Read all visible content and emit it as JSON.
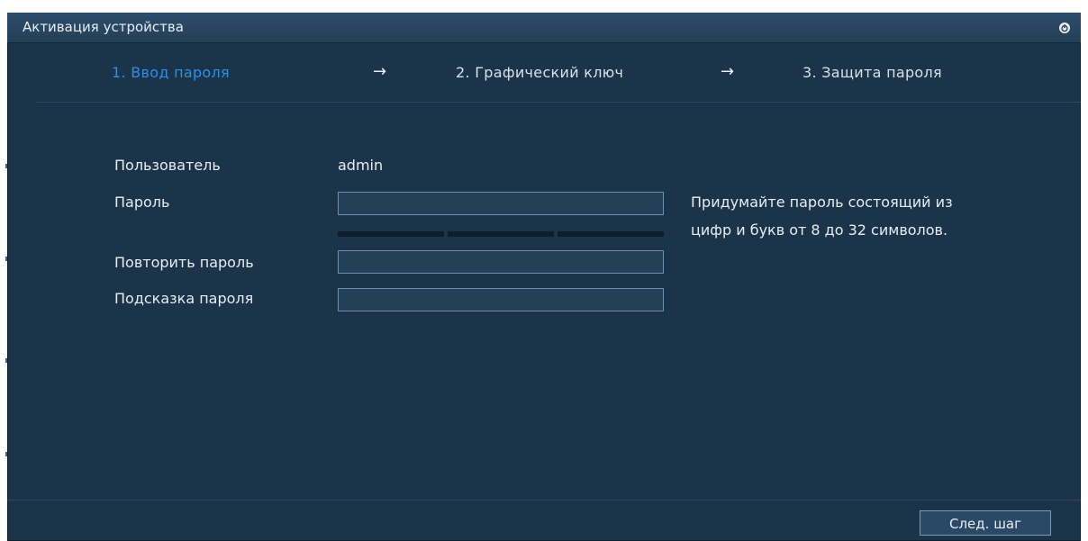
{
  "window": {
    "title": "Активация устройства",
    "power_icon": "power-icon"
  },
  "steps": [
    {
      "label": "1.  Ввод пароля",
      "active": true
    },
    {
      "label": "2.  Графический ключ",
      "active": false
    },
    {
      "label": "3.  Защита пароля",
      "active": false
    }
  ],
  "step_arrow": "→",
  "form": {
    "user_label": "Пользователь",
    "user_value": "admin",
    "password_label": "Пароль",
    "password_value": "",
    "repeat_label": "Повторить пароль",
    "repeat_value": "",
    "hint_label": "Подсказка пароля",
    "hint_value": ""
  },
  "password_hint": {
    "line1": "Придумайте пароль состоящий из",
    "line2": "цифр и букв от 8 до 32 символов."
  },
  "strength_level": 0,
  "next_button": "След. шаг",
  "colors": {
    "background": "#1b3449",
    "titlebar": "#234058",
    "active_step": "#2d8fe6",
    "text": "#e6edf3",
    "input_border": "#6b8fb0"
  }
}
